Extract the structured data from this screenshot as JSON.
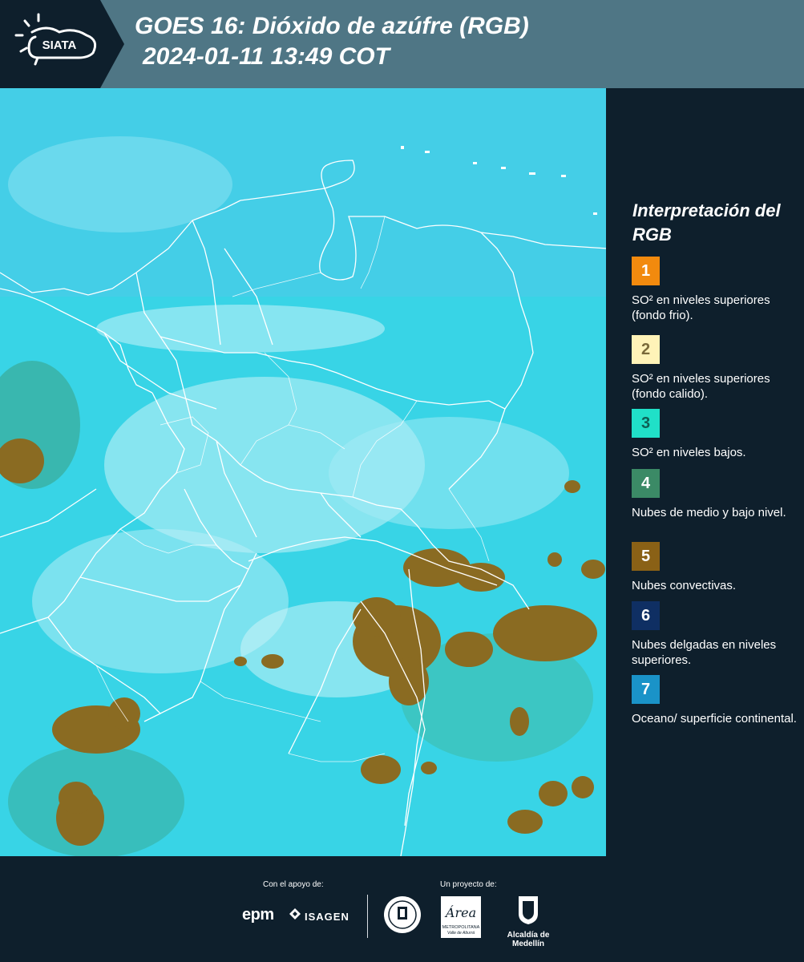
{
  "header": {
    "logo_text": "SIATA",
    "title_line1": "GOES 16: Dióxido de azúfre (RGB)",
    "title_line2": "2024-01-11 13:49 COT"
  },
  "legend": {
    "title": "Interpretación del RGB",
    "items": [
      {
        "number": "1",
        "label": "SO² en niveles superiores (fondo frio).",
        "color": "#f28a0e",
        "text_color": "#ffffff"
      },
      {
        "number": "2",
        "label": "SO² en niveles superiores (fondo calido).",
        "color": "#fff3b8",
        "text_color": "#7a6a3a"
      },
      {
        "number": "3",
        "label": "SO² en niveles bajos.",
        "color": "#20e0c8",
        "text_color": "#0e5f55"
      },
      {
        "number": "4",
        "label": "Nubes de medio y bajo nivel.",
        "color": "#3b8a66",
        "text_color": "#ffffff"
      },
      {
        "number": "5",
        "label": "Nubes convectivas.",
        "color": "#8a6116",
        "text_color": "#ffffff"
      },
      {
        "number": "6",
        "label": "Nubes delgadas en niveles superiores.",
        "color": "#0f2f63",
        "text_color": "#ffffff"
      },
      {
        "number": "7",
        "label": "Oceano/ superficie continental.",
        "color": "#1a93c8",
        "text_color": "#ffffff"
      }
    ]
  },
  "footer": {
    "support_label": "Con el apoyo de:",
    "project_label": "Un proyecto de:",
    "sponsor1": "epm",
    "sponsor2": "ISAGEN",
    "partner1_text": "METROPOLITANA",
    "partner1_sub": "Valle de Aburrá",
    "partner1_mark": "Área",
    "partner2": "Alcaldía de Medellín"
  },
  "map": {
    "background_color": "#38d4e6",
    "convective_color": "#8a6b22",
    "border_color": "#ffffff"
  }
}
